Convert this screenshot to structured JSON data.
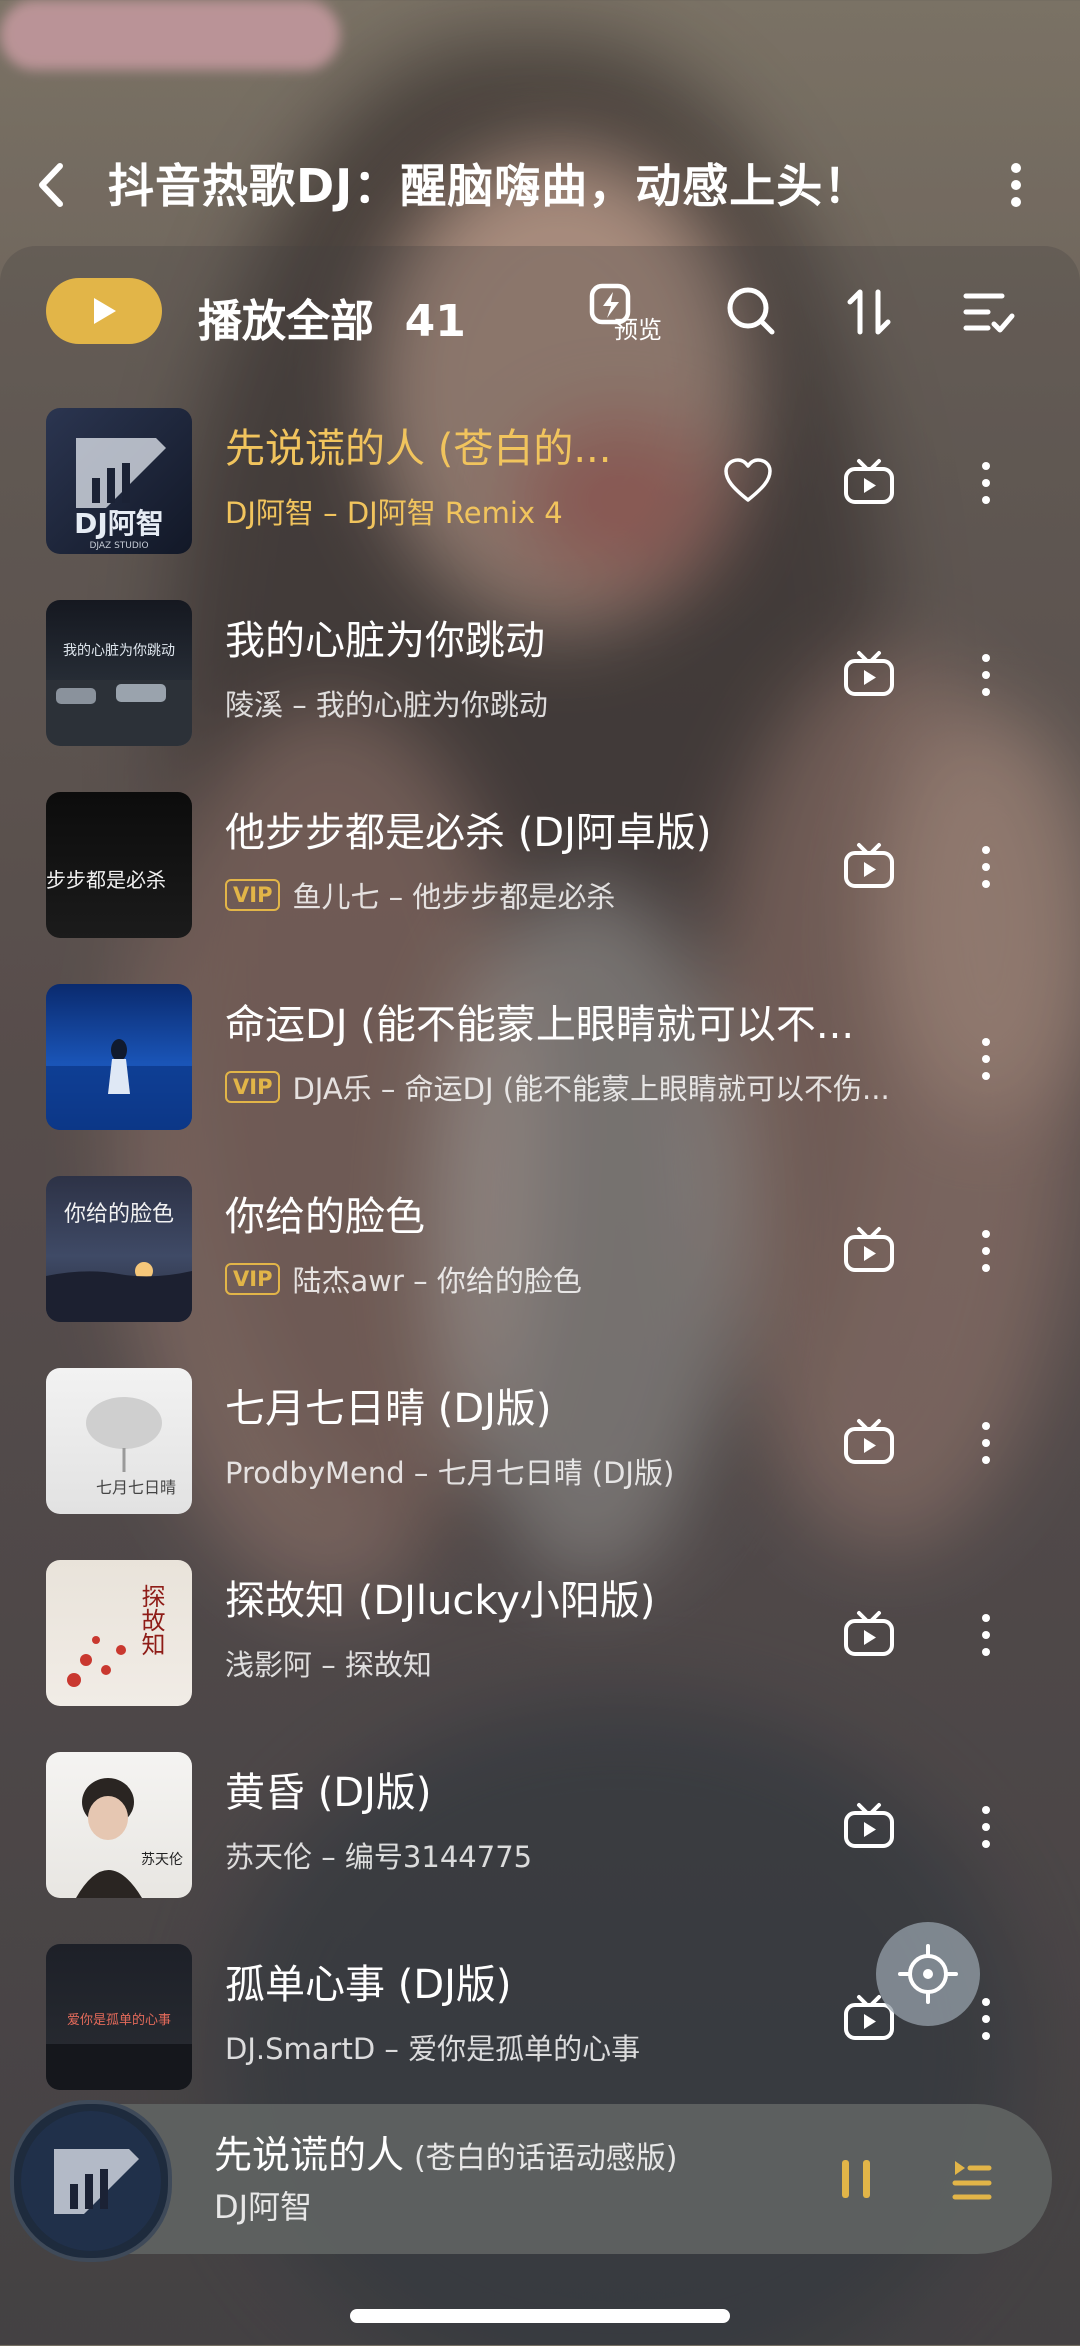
{
  "header": {
    "title": "抖音热歌DJ：醒脑嗨曲，动感上头！"
  },
  "toolbar": {
    "play_all_label": "播放全部",
    "count": "41",
    "preview_label": "预览"
  },
  "cover_text": {
    "c1": "DJ阿智",
    "c1b": "DJAZ STUDIO",
    "c2": "我的心脏为你跳动",
    "c3": "他步步都是必杀",
    "c5": "你给的脸色",
    "c6": "七月七日晴",
    "c7": "探故知",
    "c8": "苏天伦",
    "c9": "爱你是孤单的心事"
  },
  "songs": [
    {
      "title": "先说谎的人 (苍白的...",
      "vip": false,
      "sub": "DJ阿智 – DJ阿智 Remix 4",
      "active": true
    },
    {
      "title": "我的心脏为你跳动",
      "vip": false,
      "sub": "陵溪 – 我的心脏为你跳动"
    },
    {
      "title": "他步步都是必杀 (DJ阿卓版)",
      "vip": true,
      "vip_label": "VIP",
      "sub": "鱼儿七 – 他步步都是必杀"
    },
    {
      "title": "命运DJ (能不能蒙上眼睛就可以不...",
      "vip": true,
      "vip_label": "VIP",
      "sub": "DJA乐 – 命运DJ (能不能蒙上眼睛就可以不伤..."
    },
    {
      "title": "你给的脸色",
      "vip": true,
      "vip_label": "VIP",
      "sub": "陆杰awr – 你给的脸色"
    },
    {
      "title": "七月七日晴 (DJ版)",
      "vip": false,
      "sub": "ProdbyMend – 七月七日晴 (DJ版)"
    },
    {
      "title": "探故知 (DJlucky小阳版)",
      "vip": false,
      "sub": "浅影阿 – 探故知"
    },
    {
      "title": "黄昏 (DJ版)",
      "vip": false,
      "sub": "苏天伦 – 编号3144775"
    },
    {
      "title": "孤单心事 (DJ版)",
      "vip": false,
      "sub": "DJ.SmartD – 爱你是孤单的心事"
    }
  ],
  "player": {
    "title": "先说谎的人",
    "subtitle": "(苍白的话语动感版)",
    "artist": "DJ阿智"
  },
  "colors": {
    "accent": "#e2b548",
    "active_text": "#f1c45d"
  }
}
